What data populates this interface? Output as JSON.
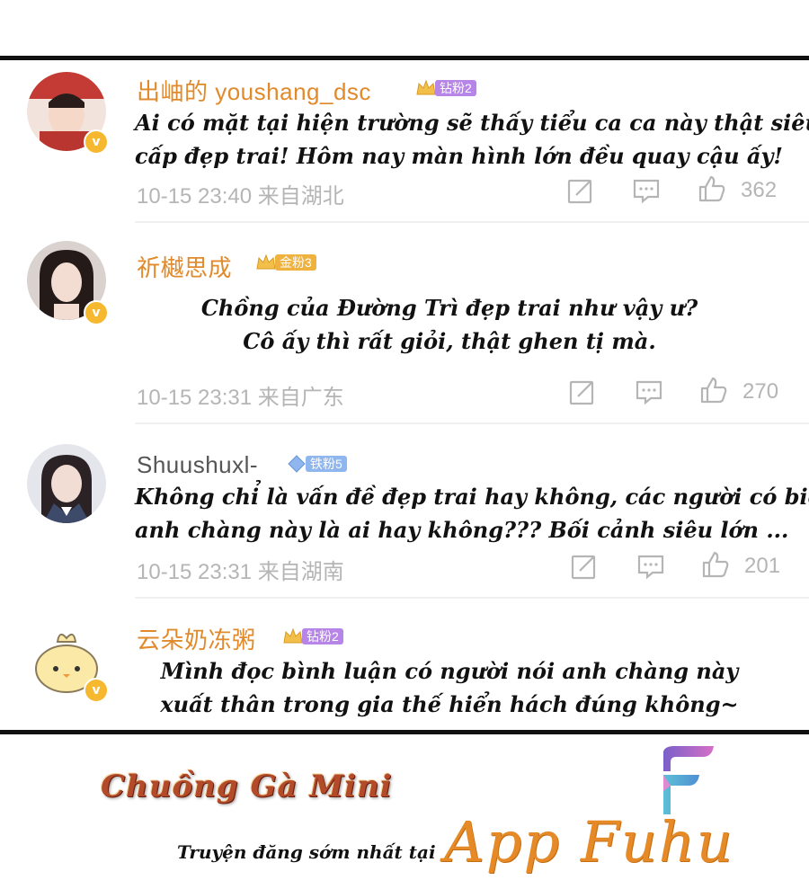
{
  "comments": [
    {
      "username": "出岫的 youshang_dsc",
      "fan_badge": "钻粉2",
      "fan_badge_color": "#b784e8",
      "text_lines": [
        "Ai có mặt tại hiện trường sẽ thấy tiểu ca ca này thật siêu",
        "cấp đẹp trai! Hôm nay màn hình lớn đều quay cậu ấy!"
      ],
      "time": "10-15 23:40 来自湖北",
      "likes": "362"
    },
    {
      "username": "祈樾思成",
      "fan_badge": "金粉3",
      "fan_badge_color": "#f0b23e",
      "text_lines": [
        "Chồng của Đường Trì đẹp trai như vậy ư?",
        "Cô ấy thì rất giỏi, thật ghen tị mà."
      ],
      "time": "10-15 23:31 来自广东",
      "likes": "270"
    },
    {
      "username": "Shuushuxl-",
      "fan_badge": "铁粉5",
      "fan_badge_color": "#8fb6ee",
      "text_lines": [
        "Không chỉ là vấn đề đẹp trai hay không, các người có biết",
        "anh chàng này là ai hay không???  Bối cảnh siêu lớn ..."
      ],
      "time": "10-15 23:31 来自湖南",
      "likes": "201"
    },
    {
      "username": "云朵奶冻粥",
      "fan_badge": "钻粉2",
      "fan_badge_color": "#b784e8",
      "text_lines": [
        "Mình đọc bình luận có người nói anh chàng này",
        "xuất thân trong gia thế hiển hách đúng không~"
      ]
    }
  ],
  "verified_mark": "v",
  "footer": {
    "group_name": "Chuồng Gà Mini",
    "tagline": "Truyện đăng sớm nhất tại",
    "app_name": "App Fuhu"
  },
  "icons": [
    "repost-icon",
    "comment-icon",
    "like-icon",
    "crown-icon",
    "verified-badge-icon",
    "app-f-logo-icon"
  ]
}
